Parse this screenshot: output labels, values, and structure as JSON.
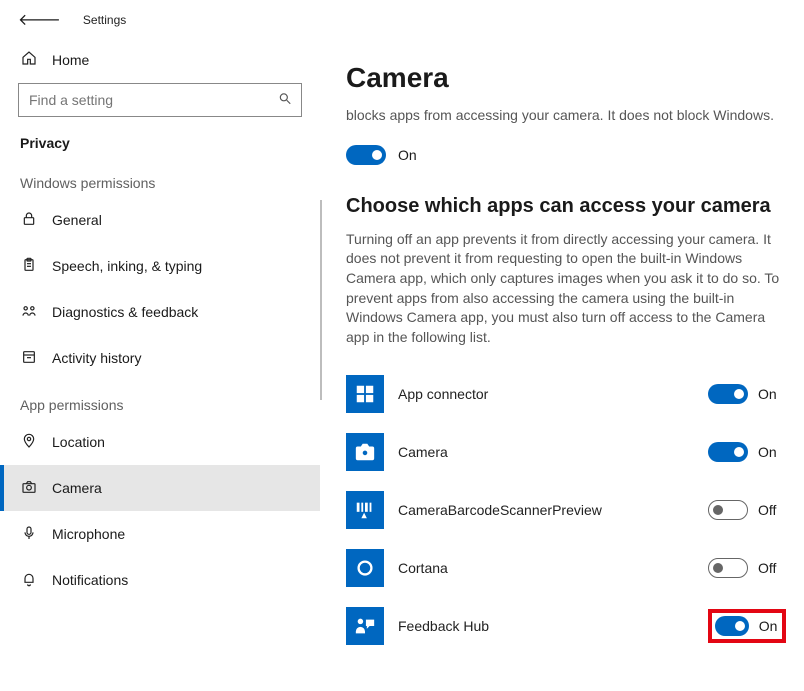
{
  "titlebar": {
    "label": "Settings"
  },
  "sidebar": {
    "home_label": "Home",
    "search_placeholder": "Find a setting",
    "privacy_label": "Privacy",
    "windows_perms_header": "Windows permissions",
    "app_perms_header": "App permissions",
    "windows_items": [
      {
        "label": "General",
        "icon": "lock"
      },
      {
        "label": "Speech, inking, & typing",
        "icon": "clipboard"
      },
      {
        "label": "Diagnostics & feedback",
        "icon": "feedback"
      },
      {
        "label": "Activity history",
        "icon": "history"
      }
    ],
    "app_items": [
      {
        "label": "Location",
        "icon": "location",
        "active": false
      },
      {
        "label": "Camera",
        "icon": "camera",
        "active": true
      },
      {
        "label": "Microphone",
        "icon": "mic",
        "active": false
      },
      {
        "label": "Notifications",
        "icon": "bell",
        "active": false
      }
    ]
  },
  "main": {
    "title": "Camera",
    "desc": "blocks apps from accessing your camera. It does not block Windows.",
    "master_toggle": {
      "state": "On",
      "on": true
    },
    "section_title": "Choose which apps can access your camera",
    "section_desc": "Turning off an app prevents it from directly accessing your camera. It does not prevent it from requesting to open the built-in Windows Camera app, which only captures images when you ask it to do so. To prevent apps from also accessing the camera using the built-in Windows Camera app, you must also turn off access to the Camera app in the following list.",
    "apps": [
      {
        "name": "App connector",
        "state": "On",
        "on": true,
        "highlight": false
      },
      {
        "name": "Camera",
        "state": "On",
        "on": true,
        "highlight": false
      },
      {
        "name": "CameraBarcodeScannerPreview",
        "state": "Off",
        "on": false,
        "highlight": false
      },
      {
        "name": "Cortana",
        "state": "Off",
        "on": false,
        "highlight": false
      },
      {
        "name": "Feedback Hub",
        "state": "On",
        "on": true,
        "highlight": true
      }
    ],
    "labels": {
      "on": "On",
      "off": "Off"
    }
  }
}
